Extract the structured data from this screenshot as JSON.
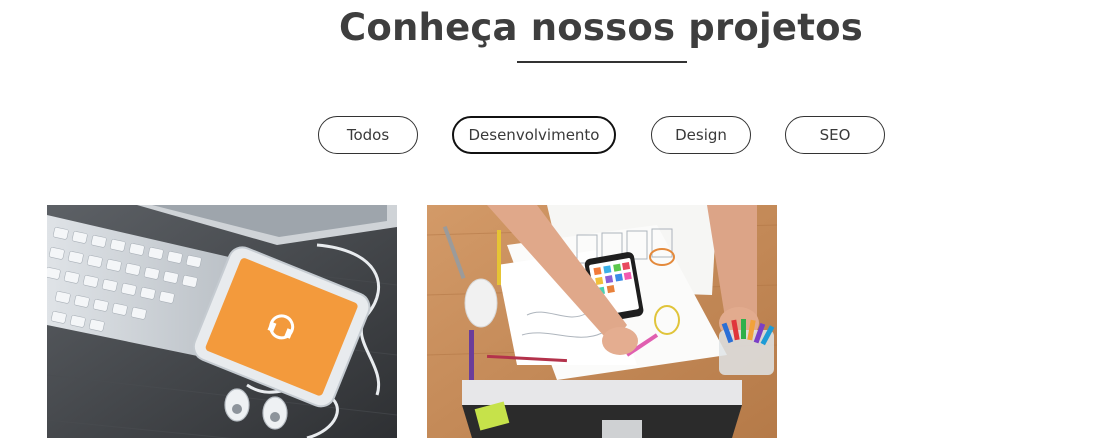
{
  "section": {
    "title": "Conheça nossos projetos"
  },
  "filters": [
    {
      "label": "Todos",
      "active": false
    },
    {
      "label": "Desenvolvimento",
      "active": true
    },
    {
      "label": "Design",
      "active": false
    },
    {
      "label": "SEO",
      "active": false
    }
  ],
  "projects": [
    {
      "image": "smartphone-keyboard-earphones-photo"
    },
    {
      "image": "desk-workspace-sketches-photo"
    }
  ],
  "colors": {
    "title": "#3e3e3e",
    "border": "#333333",
    "phone_screen": "#f39a3c",
    "desk_wood": "#c98a55"
  }
}
